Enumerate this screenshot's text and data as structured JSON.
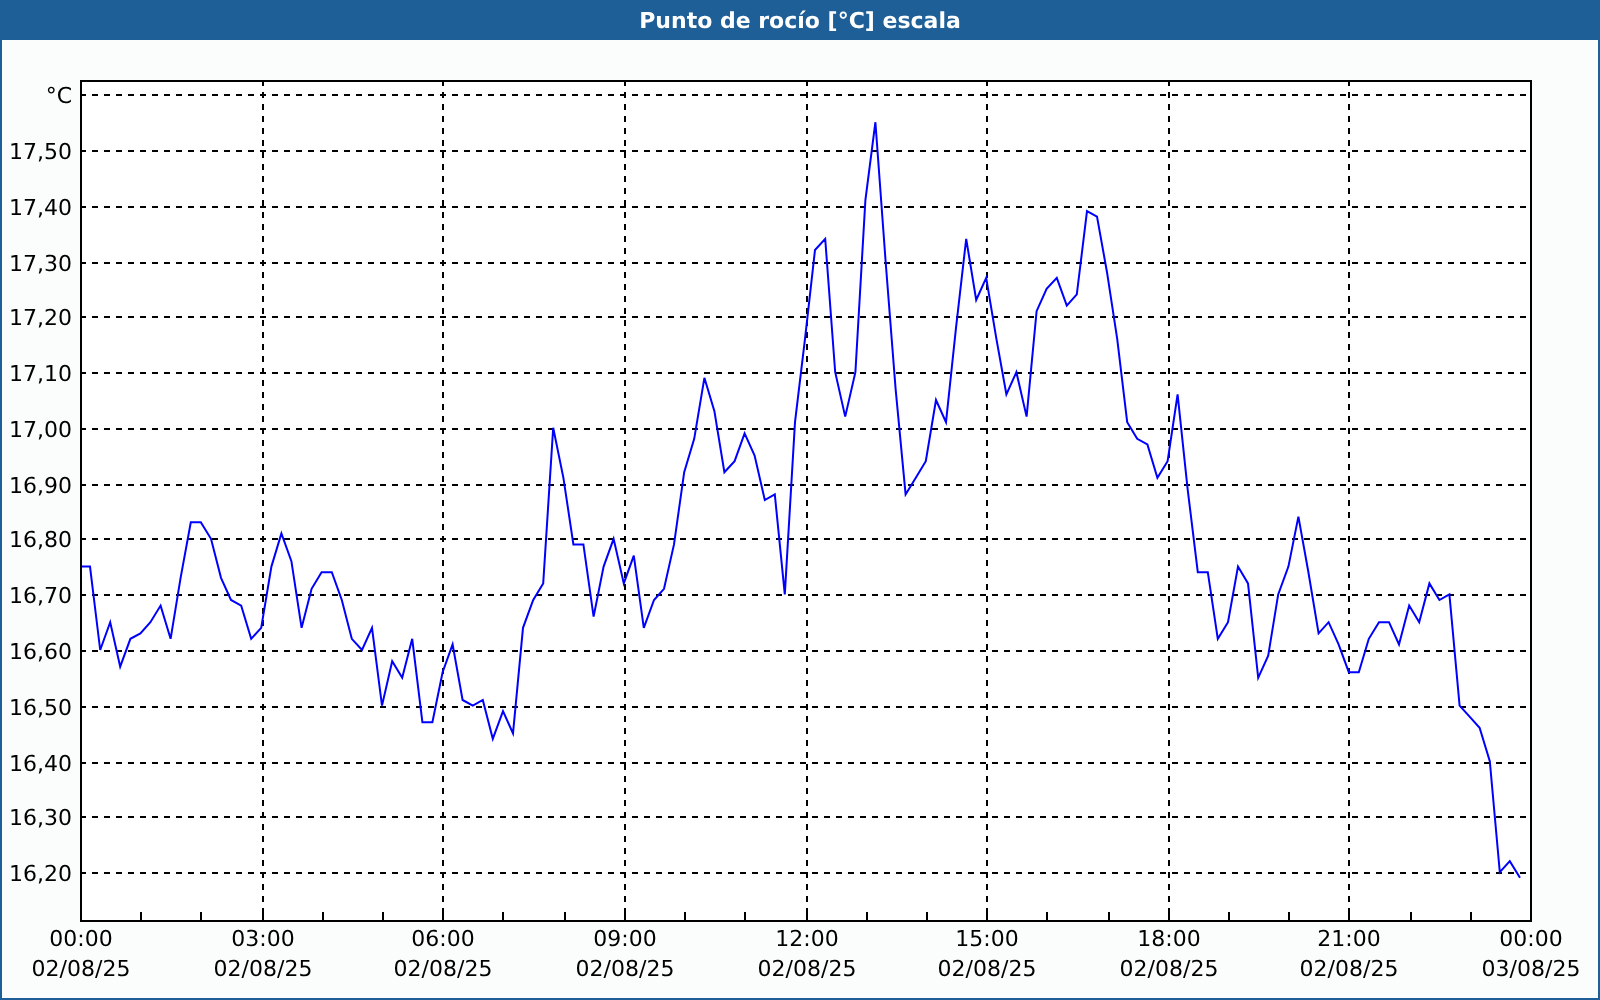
{
  "chart": {
    "chart_data": {
      "type": "line",
      "title": "Punto de rocío [°C] escala",
      "categories": [
        "00:00\n02/08/25",
        null,
        null,
        null,
        null,
        null,
        null,
        null,
        null,
        null,
        null,
        null,
        null,
        null,
        null,
        null,
        null,
        null,
        "03:00\n02/08/25",
        null,
        null,
        null,
        null,
        null,
        null,
        null,
        null,
        null,
        null,
        null,
        null,
        null,
        null,
        null,
        null,
        null,
        "06:00\n02/08/25",
        null,
        null,
        null,
        null,
        null,
        null,
        null,
        null,
        null,
        null,
        null,
        null,
        null,
        null,
        null,
        null,
        null,
        "09:00\n02/08/25",
        null,
        null,
        null,
        null,
        null,
        null,
        null,
        null,
        null,
        null,
        null,
        null,
        null,
        null,
        null,
        null,
        null,
        "12:00\n02/08/25",
        null,
        null,
        null,
        null,
        null,
        null,
        null,
        null,
        null,
        null,
        null,
        null,
        null,
        null,
        null,
        null,
        null,
        "15:00\n02/08/25",
        null,
        null,
        null,
        null,
        null,
        null,
        null,
        null,
        null,
        null,
        null,
        null,
        null,
        null,
        null,
        null,
        null,
        "18:00\n02/08/25",
        null,
        null,
        null,
        null,
        null,
        null,
        null,
        null,
        null,
        null,
        null,
        null,
        null,
        null,
        null,
        null,
        null,
        "21:00\n02/08/25",
        null,
        null,
        null,
        null,
        null,
        null,
        null,
        null,
        null,
        null,
        null,
        null,
        null,
        null,
        null,
        null,
        null,
        "00:00\n03/08/25"
      ],
      "series": [
        {
          "color": "#0000ff",
          "values": [
            16.75,
            16.75,
            16.6,
            16.65,
            16.57,
            16.62,
            16.63,
            16.65,
            16.68,
            16.62,
            16.73,
            16.83,
            16.83,
            16.8,
            16.73,
            16.69,
            16.68,
            16.62,
            16.64,
            16.75,
            16.81,
            16.76,
            16.64,
            16.71,
            16.74,
            16.74,
            16.69,
            16.62,
            16.6,
            16.64,
            16.5,
            16.58,
            16.55,
            16.62,
            16.47,
            16.47,
            16.56,
            16.61,
            16.51,
            16.5,
            16.51,
            16.44,
            16.49,
            16.45,
            16.64,
            16.69,
            16.72,
            17.0,
            16.91,
            16.79,
            16.79,
            16.66,
            16.75,
            16.8,
            16.72,
            16.77,
            16.64,
            16.69,
            16.71,
            16.79,
            16.92,
            16.98,
            17.09,
            17.03,
            16.92,
            16.94,
            16.99,
            16.95,
            16.87,
            16.88,
            16.7,
            17.01,
            17.16,
            17.32,
            17.34,
            17.1,
            17.02,
            17.1,
            17.41,
            17.55,
            17.3,
            17.07,
            16.88,
            16.91,
            16.94,
            17.05,
            17.01,
            17.18,
            17.34,
            17.23,
            17.27,
            17.16,
            17.06,
            17.1,
            17.02,
            17.21,
            17.25,
            17.27,
            17.22,
            17.24,
            17.39,
            17.38,
            17.28,
            17.16,
            17.01,
            16.98,
            16.97,
            16.91,
            16.94,
            17.06,
            16.89,
            16.74,
            16.74,
            16.62,
            16.65,
            16.75,
            16.72,
            16.55,
            16.59,
            16.7,
            16.75,
            16.84,
            16.74,
            16.63,
            16.65,
            16.61,
            16.56,
            16.56,
            16.62,
            16.65,
            16.65,
            16.61,
            16.68,
            16.65,
            16.72,
            16.69,
            16.7,
            16.5,
            16.48,
            16.46,
            16.4,
            16.2,
            16.22,
            16.19,
            null
          ]
        }
      ],
      "ylim": [
        16.114,
        17.626
      ],
      "grid": true,
      "yticks": [
        {
          "value": 16.2,
          "label": "16,20"
        },
        {
          "value": 16.3,
          "label": "16,30"
        },
        {
          "value": 16.4,
          "label": "16,40"
        },
        {
          "value": 16.5,
          "label": "16,50"
        },
        {
          "value": 16.6,
          "label": "16,60"
        },
        {
          "value": 16.7,
          "label": "16,70"
        },
        {
          "value": 16.8,
          "label": "16,80"
        },
        {
          "value": 16.9,
          "label": "16,90"
        },
        {
          "value": 17.0,
          "label": "17,00"
        },
        {
          "value": 17.1,
          "label": "17,10"
        },
        {
          "value": 17.2,
          "label": "17,20"
        },
        {
          "value": 17.3,
          "label": "17,30"
        },
        {
          "value": 17.4,
          "label": "17,40"
        },
        {
          "value": 17.5,
          "label": "17,50"
        },
        {
          "value": 17.6,
          "label": "°C"
        }
      ]
    }
  }
}
